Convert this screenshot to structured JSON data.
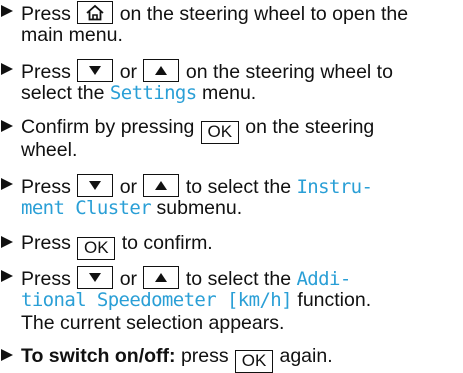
{
  "colors": {
    "highlight": "#2a9fd6",
    "text": "#111111"
  },
  "icons": {
    "home": "home-icon",
    "down": "down-arrow-icon",
    "up": "up-arrow-icon",
    "bullet": "triangle-bullet-icon"
  },
  "steps": {
    "s1": {
      "a": "Press",
      "b": "on the steering wheel to open the",
      "c": "main menu."
    },
    "s2": {
      "a": "Press",
      "or": "or",
      "b": "on the steering wheel to",
      "c": "select the",
      "hl": "Settings",
      "d": "menu."
    },
    "s3": {
      "a": "Confirm by pressing",
      "key": "OK",
      "b": "on the steering",
      "c": "wheel."
    },
    "s4": {
      "a": "Press",
      "or": "or",
      "b": "to select the",
      "hl1": "Instru-",
      "hl2": "ment Cluster",
      "c": "submenu."
    },
    "s5": {
      "a": "Press",
      "key": "OK",
      "b": "to confirm."
    },
    "s6": {
      "a": "Press",
      "or": "or",
      "b": "to select the",
      "hl1": "Addi-",
      "hl2": "tional Speedometer [km/h]",
      "c": "function.",
      "d": "The current selection appears."
    },
    "s7": {
      "bold": "To switch on/off:",
      "a": "press",
      "key": "OK",
      "b": "again."
    }
  }
}
